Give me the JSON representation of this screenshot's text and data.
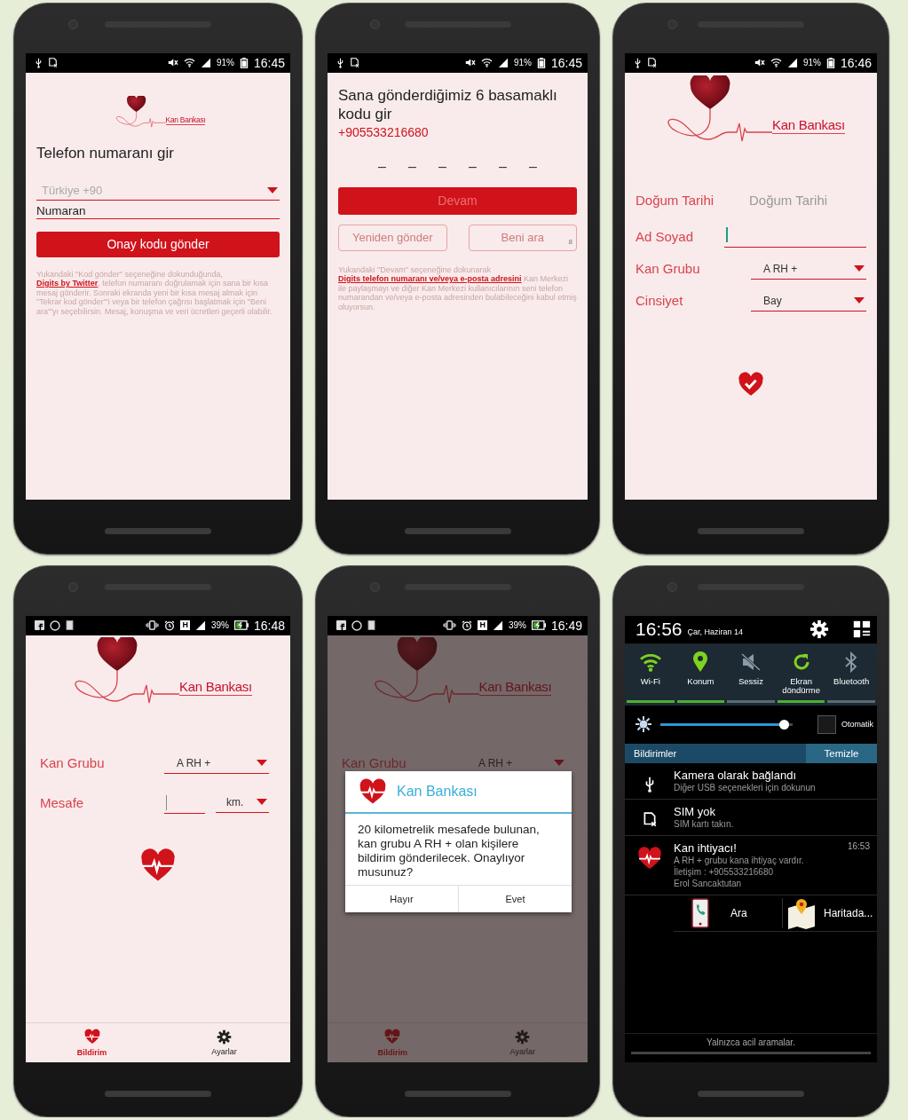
{
  "phones": [
    {
      "kind": "phone_entry",
      "status_bar": {
        "kind": "samsung",
        "battery": "91%",
        "time": "16:45"
      },
      "logo": "Kan Bankası",
      "title": "Telefon numaranı gir",
      "country": {
        "value": "Türkiye +90"
      },
      "phone_field": {
        "placeholder": "Numaran"
      },
      "submit_button": {
        "label": "Onay kodu gönder",
        "disabled": false
      },
      "notice": {
        "before": "Yukandaki \"Kod gönder\" seçeneğine dokunduğunda, ",
        "link": "Digits by Twitter",
        "after": ", telefon numaranı doğrulamak için sana bir kısa mesaj gönderir. Sonraki ekranda yeni bir kısa mesaj almak için \"Tekrar kod gönder\"'i veya bir telefon çağrısı başlatmak için \"Beni ara\"'yı seçebilirsin. Mesaj, konuşma ve veri ücretleri geçerli olabilir."
      }
    },
    {
      "kind": "code_entry",
      "status_bar": {
        "kind": "samsung",
        "battery": "91%",
        "time": "16:45"
      },
      "title": "Sana gönderdiğimiz 6 basamaklı kodu gir",
      "phone": "+905533216680",
      "code_slots": [
        {
          "placeholder": "–"
        },
        {
          "placeholder": "–"
        },
        {
          "placeholder": "–"
        },
        {
          "placeholder": "–"
        },
        {
          "placeholder": "–"
        },
        {
          "placeholder": "–"
        }
      ],
      "continue_button": {
        "label": "Devam",
        "disabled": true
      },
      "resend_button": {
        "label": "Yeniden gönder",
        "disabled": true
      },
      "call_button": {
        "label": "Beni ara",
        "countdown": "8",
        "disabled": true
      },
      "notice": {
        "before": "Yukandaki \"Devam\" seçeneğine dokunarak ",
        "link": "Digits telefon numaranı ve/veya e-posta adresini",
        "after": " Kan Merkezi ile paylaşmayı ve diğer Kan Merkezi kullanıcılarının seni telefon numarandan ve/veya e-posta adresinden bulabileceğini kabul etmiş oluyorsun."
      }
    },
    {
      "kind": "register",
      "status_bar": {
        "kind": "samsung",
        "battery": "91%",
        "time": "16:46"
      },
      "logo": "Kan Bankası",
      "fields": [
        {
          "kind": "date",
          "label": "Doğum Tarihi",
          "placeholder": "Doğum Tarihi"
        },
        {
          "kind": "text",
          "label": "Ad Soyad",
          "focused": true
        },
        {
          "kind": "select",
          "label": "Kan Grubu",
          "value": "A RH +"
        },
        {
          "kind": "select",
          "label": "Cinsiyet",
          "value": "Bay"
        }
      ]
    },
    {
      "kind": "request",
      "status_bar": {
        "kind": "stock",
        "network": "H",
        "battery": "39%",
        "time": "16:48"
      },
      "logo": "Kan Bankası",
      "fields": [
        {
          "kind": "select",
          "label": "Kan Grubu",
          "value": "A RH +"
        },
        {
          "kind": "distance",
          "label": "Mesafe",
          "focused": true,
          "unit": "km."
        }
      ],
      "nav": [
        {
          "label": "Bildirim",
          "selected": true
        },
        {
          "label": "Ayarlar",
          "selected": false
        }
      ]
    },
    {
      "kind": "request",
      "status_bar": {
        "kind": "stock",
        "network": "H",
        "battery": "39%",
        "time": "16:49"
      },
      "logo": "Kan Bankası",
      "fields": [
        {
          "kind": "select",
          "label": "Kan Grubu",
          "value": "A RH +"
        }
      ],
      "dialog": {
        "title": "Kan Bankası",
        "message": "20 kilometrelik mesafede bulunan, kan grubu A RH + olan kişilere bildirim gönderilecek. Onaylıyor musunuz?",
        "buttons": [
          "Hayır",
          "Evet"
        ]
      },
      "nav": [
        {
          "label": "Bildirim",
          "selected": true
        },
        {
          "label": "Ayarlar",
          "selected": false
        }
      ]
    },
    {
      "kind": "notification_panel",
      "time": "16:56",
      "date": "Çar, Haziran 14",
      "toggles": [
        {
          "kind": "wifi",
          "label": "Wi-Fi",
          "on": true
        },
        {
          "kind": "location",
          "label": "Konum",
          "on": true
        },
        {
          "kind": "mute",
          "label": "Sessiz",
          "on": false
        },
        {
          "kind": "rotate",
          "label": "Ekran döndürme",
          "on": true
        },
        {
          "kind": "bluetooth",
          "label": "Bluetooth",
          "on": false
        }
      ],
      "brightness": {
        "level": 0.93
      },
      "auto_brightness": {
        "label": "Otomatik",
        "checked": false
      },
      "notifications_header": {
        "title": "Bildirimler",
        "clear_button": "Temizle"
      },
      "notifications": [
        {
          "kind": "usb",
          "title": "Kamera olarak bağlandı",
          "lines": [
            "Diğer USB seçenekleri için dokunun"
          ]
        },
        {
          "kind": "sim",
          "title": "SIM yok",
          "lines": [
            "SIM kartı takın."
          ]
        },
        {
          "kind": "app",
          "title": "Kan ihtiyacı!",
          "time": "16:53",
          "lines": [
            "A RH + grubu kana ihtiyaç vardır.",
            "İletişim : +905533216680",
            "Erol Sancaktutan"
          ],
          "actions": [
            {
              "kind": "call",
              "label": "Ara"
            },
            {
              "kind": "map",
              "label": "Haritada..."
            }
          ]
        }
      ],
      "footer": "Yalnızca acil aramalar."
    }
  ]
}
